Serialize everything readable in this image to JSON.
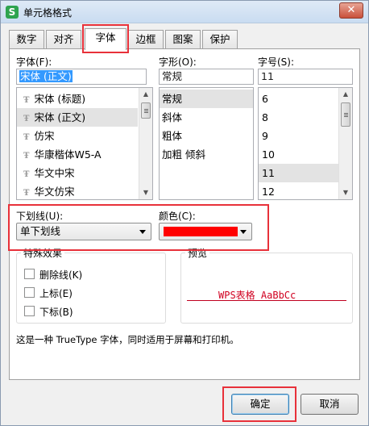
{
  "window": {
    "app_icon_letter": "S",
    "title": "单元格格式",
    "close_glyph": "✕"
  },
  "tabs": [
    {
      "label": "数字"
    },
    {
      "label": "对齐"
    },
    {
      "label": "字体",
      "active": true
    },
    {
      "label": "边框"
    },
    {
      "label": "图案"
    },
    {
      "label": "保护"
    }
  ],
  "font": {
    "label": "字体(F):",
    "value": "宋体 (正文)",
    "list": [
      "宋体 (标题)",
      "宋体 (正文)",
      "仿宋",
      "华康楷体W5-A",
      "华文中宋",
      "华文仿宋"
    ],
    "selected_index": 1
  },
  "style": {
    "label": "字形(O):",
    "value": "常规",
    "list": [
      "常规",
      "斜体",
      "粗体",
      "加粗 倾斜"
    ],
    "selected_index": 0
  },
  "size": {
    "label": "字号(S):",
    "value": "11",
    "list": [
      "6",
      "8",
      "9",
      "10",
      "11",
      "12"
    ],
    "selected_index": 4
  },
  "underline": {
    "label": "下划线(U):",
    "value": "单下划线"
  },
  "color": {
    "label": "颜色(C):",
    "value": "#ff0000"
  },
  "effects": {
    "title": "特殊效果",
    "items": [
      {
        "label": "删除线(K)",
        "checked": false
      },
      {
        "label": "上标(E)",
        "checked": false
      },
      {
        "label": "下标(B)",
        "checked": false
      }
    ]
  },
  "preview": {
    "title": "预览",
    "text": "WPS表格  AaBbCc",
    "color": "#d00020"
  },
  "description": "这是一种 TrueType 字体，同时适用于屏幕和打印机。",
  "buttons": {
    "ok": "确定",
    "cancel": "取消"
  },
  "highlight_color": "#e8313a"
}
